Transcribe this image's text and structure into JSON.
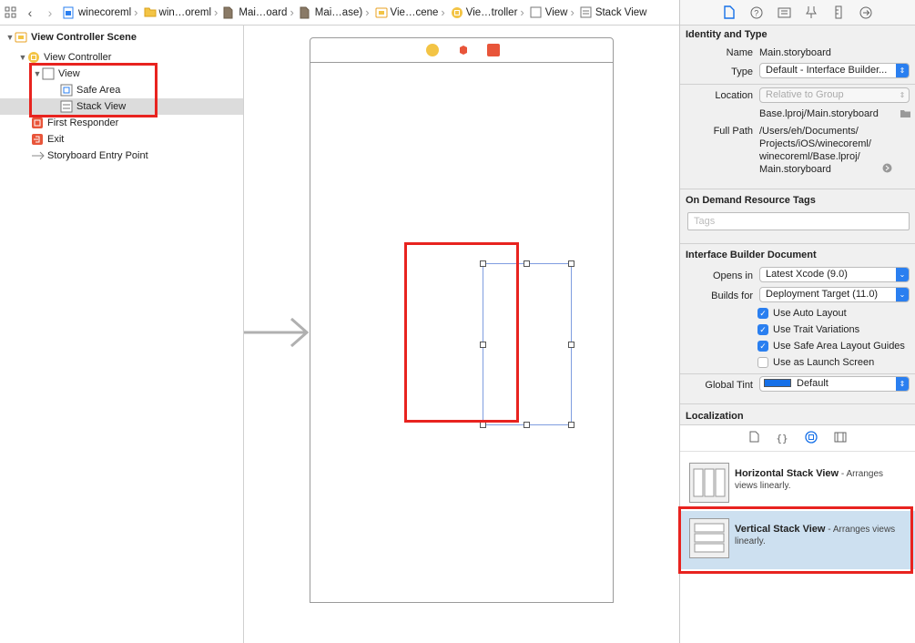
{
  "breadcrumbs": [
    "winecoreml",
    "win…oreml",
    "Mai…oard",
    "Mai…ase)",
    "Vie…cene",
    "Vie…troller",
    "View",
    "Stack View"
  ],
  "outline": {
    "scene": "View Controller Scene",
    "view_controller": "View Controller",
    "view": "View",
    "safe_area": "Safe Area",
    "stack_view": "Stack View",
    "first_responder": "First Responder",
    "exit": "Exit",
    "entry_point": "Storyboard Entry Point"
  },
  "inspector": {
    "identity": {
      "title": "Identity and Type",
      "name_label": "Name",
      "name_value": "Main.storyboard",
      "type_label": "Type",
      "type_value": "Default - Interface Builder...",
      "location_label": "Location",
      "location_value": "Relative to Group",
      "location_path": "Base.lproj/Main.storyboard",
      "fullpath_label": "Full Path",
      "fullpath_lines": [
        "/Users/eh/Documents/",
        "Projects/iOS/winecoreml/",
        "winecoreml/Base.lproj/",
        "Main.storyboard"
      ]
    },
    "tags": {
      "title": "On Demand Resource Tags",
      "placeholder": "Tags"
    },
    "ibdoc": {
      "title": "Interface Builder Document",
      "opens_label": "Opens in",
      "opens_value": "Latest Xcode (9.0)",
      "builds_label": "Builds for",
      "builds_value": "Deployment Target (11.0)",
      "checks": [
        {
          "label": "Use Auto Layout",
          "checked": true
        },
        {
          "label": "Use Trait Variations",
          "checked": true
        },
        {
          "label": "Use Safe Area Layout Guides",
          "checked": true
        },
        {
          "label": "Use as Launch Screen",
          "checked": false
        }
      ],
      "tint_label": "Global Tint",
      "tint_value": "Default",
      "tint_color": "#1670e8"
    },
    "localization": {
      "title": "Localization"
    }
  },
  "library": [
    {
      "name": "Horizontal Stack View",
      "desc": " - Arranges views linearly."
    },
    {
      "name": "Vertical Stack View",
      "desc": " - Arranges views linearly."
    }
  ],
  "colors": {
    "accent": "#2a7ff0",
    "highlight": "#e8231f",
    "selection": "#cde0f0"
  }
}
